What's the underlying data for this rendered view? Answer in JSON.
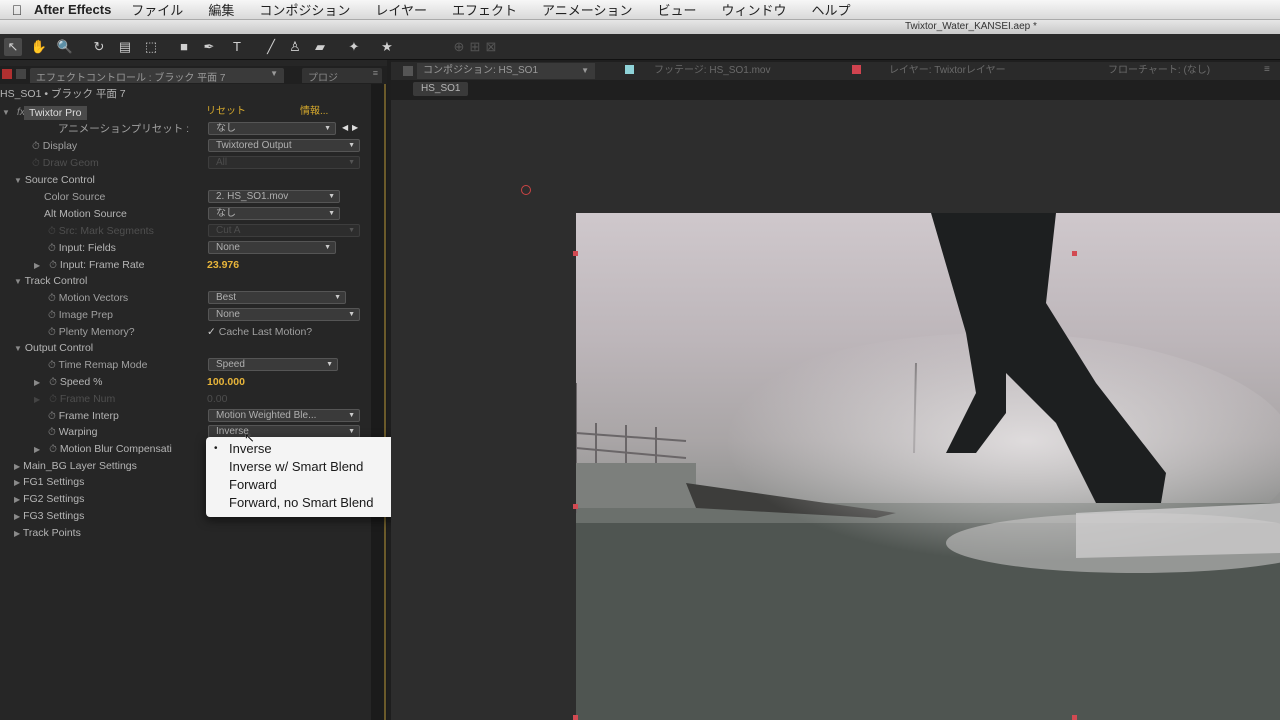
{
  "menubar": {
    "app": "After Effects",
    "items": [
      "ファイル",
      "編集",
      "コンポジション",
      "レイヤー",
      "エフェクト",
      "アニメーション",
      "ビュー",
      "ウィンドウ",
      "ヘルプ"
    ]
  },
  "window_title": "Twixtor_Water_KANSEI.aep *",
  "effect_panel": {
    "tab_label": "エフェクトコントロール : ブラック 平面 7",
    "tab2_label": "プロジ",
    "layer_path": "HS_SO1 • ブラック 平面 7",
    "effect_name": "Twixtor Pro",
    "reset": "リセット",
    "about": "情報...",
    "rows": {
      "preset": {
        "label": "アニメーションプリセット :",
        "value": "なし"
      },
      "display": {
        "label": "Display",
        "value": "Twixtored Output"
      },
      "draw_geom": {
        "label": "Draw Geom",
        "value": "All"
      },
      "source_control": {
        "label": "Source Control"
      },
      "color_source": {
        "label": "Color Source",
        "value": "2. HS_SO1.mov"
      },
      "alt_motion_source": {
        "label": "Alt Motion Source",
        "value": "なし"
      },
      "src_mark_segments": {
        "label": "Src: Mark Segments",
        "value": "Cut A"
      },
      "input_fields": {
        "label": "Input: Fields",
        "value": "None"
      },
      "input_frame_rate": {
        "label": "Input: Frame Rate",
        "value": "23.976"
      },
      "track_control": {
        "label": "Track Control"
      },
      "motion_vectors": {
        "label": "Motion Vectors",
        "value": "Best"
      },
      "image_prep": {
        "label": "Image Prep",
        "value": "None"
      },
      "plenty_memory": {
        "label": "Plenty Memory?",
        "value": "Cache Last Motion?"
      },
      "output_control": {
        "label": "Output Control"
      },
      "time_remap_mode": {
        "label": "Time Remap Mode",
        "value": "Speed"
      },
      "speed": {
        "label": "Speed %",
        "value": "100.000"
      },
      "frame_num": {
        "label": "Frame Num",
        "value": "0.00"
      },
      "frame_interp": {
        "label": "Frame Interp",
        "value": "Motion Weighted Ble..."
      },
      "warping": {
        "label": "Warping",
        "value": "Inverse"
      },
      "motion_blur": {
        "label": "Motion Blur Compensati"
      },
      "main_bg": {
        "label": "Main_BG Layer Settings"
      },
      "fg1": {
        "label": "FG1 Settings"
      },
      "fg2": {
        "label": "FG2 Settings"
      },
      "fg3": {
        "label": "FG3 Settings"
      },
      "track_points": {
        "label": "Track Points"
      }
    }
  },
  "warping_menu": {
    "selected": "Inverse",
    "options": [
      "Inverse",
      "Inverse w/ Smart Blend",
      "Forward",
      "Forward, no Smart Blend"
    ]
  },
  "comp_panel": {
    "tab_comp": "コンポジション: HS_SO1",
    "tab_footage": "フッテージ: HS_SO1.mov",
    "tab_layer": "レイヤー: Twixtorレイヤー",
    "tab_flowchart": "フローチャート: (なし)",
    "sub_tab": "HS_SO1"
  },
  "colors": {
    "value_yellow": "#e8b53a",
    "handle_red": "#d24a52",
    "footage_tab": "#8fd3d8",
    "layer_tab": "#d0434f"
  }
}
